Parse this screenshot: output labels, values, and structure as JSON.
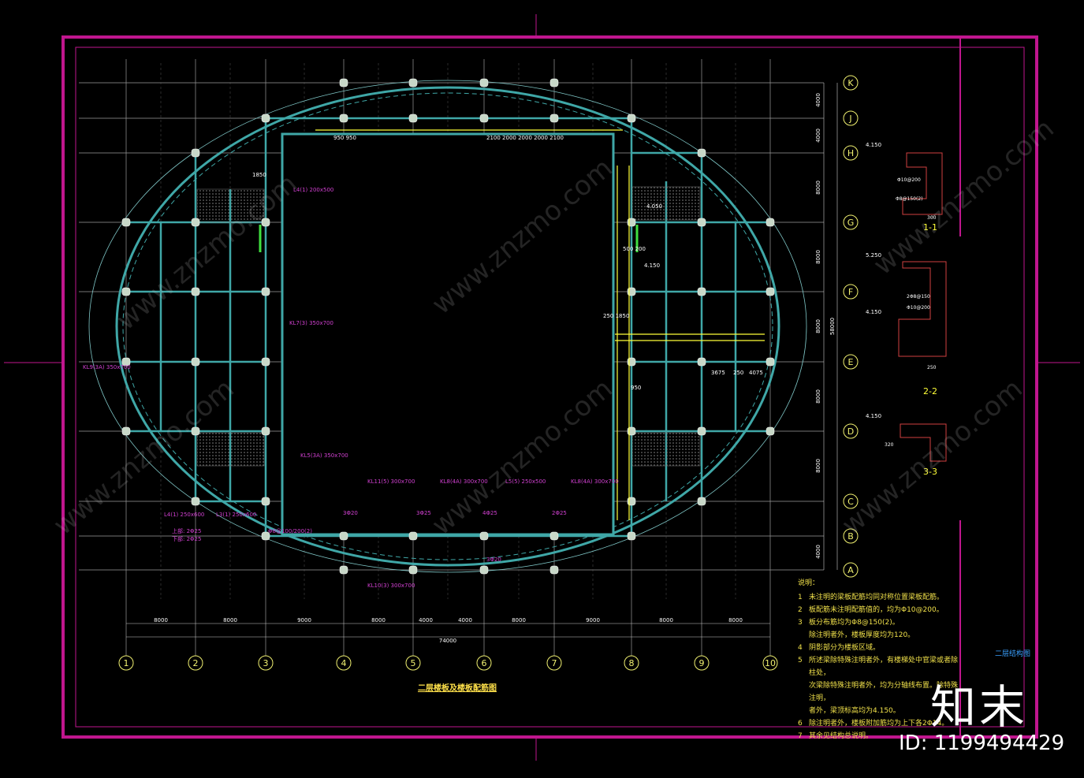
{
  "drawing": {
    "title": "二层楼板及楼板配筋图",
    "sheet_label": "二层结构图",
    "total_dimension": "74000",
    "vertical_total": "58000"
  },
  "axes_x": [
    "1",
    "2",
    "3",
    "4",
    "5",
    "6",
    "7",
    "8",
    "9",
    "10"
  ],
  "axes_y": [
    "K",
    "J",
    "H",
    "G",
    "F",
    "E",
    "D",
    "C",
    "B",
    "A"
  ],
  "spans_x": [
    "8000",
    "8000",
    "9000",
    "8000",
    "4000",
    "4000",
    "8000",
    "9000",
    "8000",
    "8000"
  ],
  "spans_y": [
    "4000",
    "4000",
    "8000",
    "8000",
    "8000",
    "8000",
    "8000",
    "4000"
  ],
  "beam_labels": [
    "L4(1) 200x500",
    "KL11(5) 300x700",
    "KL8(4A) 300x700",
    "L5(5) 250x500",
    "KL8(4A) 300x700",
    "KL10(3) 300x700",
    "L4(1) 250x600",
    "L3(1) 250x600",
    "KL9(3A) 350x700",
    "KL7(3) 350x700",
    "KL5(3A) 350x700"
  ],
  "rebar_labels": [
    "3Φ20",
    "3Φ25",
    "4Φ25",
    "2Φ25",
    "3Φ20",
    "Φ8@100/200(2)",
    "上部: 2Φ25",
    "下部: 2Φ25"
  ],
  "misc_dims": [
    "950 950",
    "2100 2000 2000 2000 2100",
    "1850",
    "3675",
    "250",
    "4075",
    "950",
    "250 1850",
    "500 200",
    "4.150",
    "4.050"
  ],
  "sections": [
    {
      "name": "1-1",
      "elev": "4.150",
      "rebar1": "Φ10@200",
      "rebar2": "Φ8@150(2)",
      "dim": "300"
    },
    {
      "name": "2-2",
      "elev_top": "5.250",
      "elev": "4.150",
      "rebar1": "2Φ8@150",
      "rebar2": "Φ10@200",
      "dim": "250"
    },
    {
      "name": "3-3",
      "elev": "4.150",
      "dim": "320"
    }
  ],
  "notes": {
    "title": "说明：",
    "items": [
      {
        "n": "1",
        "t": "未注明的梁板配筋均同对称位置梁板配筋。"
      },
      {
        "n": "2",
        "t": "板配筋未注明配筋值的，均为Φ10@200。"
      },
      {
        "n": "3",
        "t": "板分布筋均为Φ8@150(2)。"
      },
      {
        "n": "",
        "t": "除注明者外，楼板厚度均为120。"
      },
      {
        "n": "4",
        "t": "阴影部分为楼板区域。"
      },
      {
        "n": "5",
        "t": "所述梁除特殊注明者外，有楼梯处中官梁或者除柱处，"
      },
      {
        "n": "",
        "t": "次梁除特殊注明者外，均为分轴线布置。除特殊注明，"
      },
      {
        "n": "",
        "t": "者外，梁顶标高均为4.150。"
      },
      {
        "n": "6",
        "t": "除注明者外，楼板附加筋均为上下各2Φ14。"
      },
      {
        "n": "7",
        "t": "其余见结构总说明。"
      }
    ]
  },
  "watermark": {
    "brand": "知末",
    "site": "www.znzmo.com",
    "id_text": "ID: 1199494429"
  },
  "colors": {
    "frame": "#c0168e",
    "grid": "#9a9a9a",
    "beam": "#3fa7a7",
    "ellipse": "#7fc7c7",
    "rebar": "#ffff38",
    "label": "#d040d0",
    "axis_text": "#ffffff",
    "bubble": "#f0f070"
  }
}
